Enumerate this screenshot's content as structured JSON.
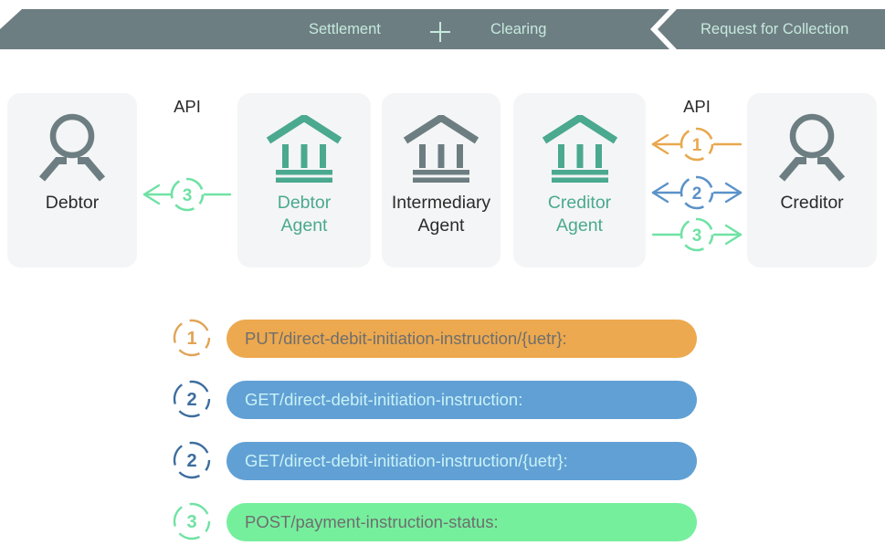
{
  "banner": {
    "settlement_label": "Settlement",
    "plus_icon": "plus-icon",
    "clearing_label": "Clearing",
    "request_label": "Request for Collection",
    "bar_color": "#6d7e82",
    "text_color": "#c5e9dd"
  },
  "actors": [
    {
      "id": "debtor",
      "label": "Debtor",
      "icon": "person-icon",
      "color": "#2b2b2b",
      "icon_color": "#6d7e82"
    },
    {
      "id": "debtor-agent",
      "label": "Debtor\nAgent",
      "line1": "Debtor",
      "line2": "Agent",
      "icon": "bank-icon",
      "color": "#4aa98f",
      "icon_color": "#4aa98f"
    },
    {
      "id": "intermediary-agent",
      "label": "Intermediary\nAgent",
      "line1": "Intermediary",
      "line2": "Agent",
      "icon": "bank-icon",
      "color": "#2b2b2b",
      "icon_color": "#6d7e82"
    },
    {
      "id": "creditor-agent",
      "label": "Creditor\nAgent",
      "line1": "Creditor",
      "line2": "Agent",
      "icon": "bank-icon",
      "color": "#4aa98f",
      "icon_color": "#4aa98f"
    },
    {
      "id": "creditor",
      "label": "Creditor",
      "icon": "person-icon",
      "color": "#2b2b2b",
      "icon_color": "#6d7e82"
    }
  ],
  "api_left": {
    "title": "API",
    "flows": [
      {
        "step": "3",
        "color": "#6fe2a4",
        "arrow_left": true,
        "arrow_right": false
      }
    ]
  },
  "api_right": {
    "title": "API",
    "flows": [
      {
        "step": "1",
        "color": "#e8a84e",
        "arrow_left": true,
        "arrow_right": false
      },
      {
        "step": "2",
        "color": "#5b92c8",
        "arrow_left": true,
        "arrow_right": true
      },
      {
        "step": "3",
        "color": "#6fe2a4",
        "arrow_left": false,
        "arrow_right": true
      }
    ]
  },
  "legend": [
    {
      "step": "1",
      "endpoint": "PUT/direct-debit-initiation-instruction/{uetr}:",
      "pill_color": "#eda94f",
      "badge_color": "#e0a456",
      "text_color": "#6e6e6e"
    },
    {
      "step": "2",
      "endpoint": "GET/direct-debit-initiation-instruction:",
      "pill_color": "#61a0d4",
      "badge_color": "#3d6d9e",
      "text_color": "#c8f2f7"
    },
    {
      "step": "2",
      "endpoint": "GET/direct-debit-initiation-instruction/{uetr}:",
      "pill_color": "#61a0d4",
      "badge_color": "#3d6d9e",
      "text_color": "#c8f2f7"
    },
    {
      "step": "3",
      "endpoint": "POST/payment-instruction-status:",
      "pill_color": "#76ef9d",
      "badge_color": "#6fe2a4",
      "text_color": "#6e6e6e"
    }
  ]
}
